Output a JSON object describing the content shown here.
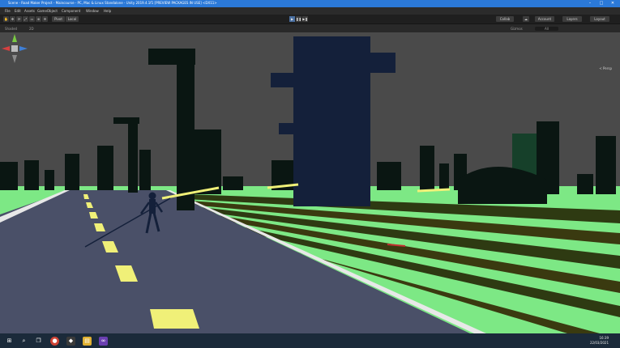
{
  "window": {
    "title": "Scene - Road Maker Project - Maincourse - PC, Mac & Linux Standalone - Unity 2019.4.1f1 [PREVIEW PACKAGES IN USE] <DX11>",
    "minimize": "–",
    "maximize": "□",
    "close": "✕"
  },
  "menu": [
    "File",
    "Edit",
    "Assets",
    "GameObject",
    "Component",
    "Window",
    "Help"
  ],
  "toolbar": {
    "tools": [
      "✋",
      "✥",
      "⟳",
      "⤢",
      "▭",
      "⊕",
      "✣"
    ],
    "pivot": "Pivot",
    "local": "Local",
    "play": "▶",
    "pause": "❚❚",
    "step": "▶❚",
    "collab": "Collab",
    "cloud": "☁",
    "account": "Account",
    "layers": "Layers",
    "layout": "Layout"
  },
  "scene_toolbar": {
    "shading": "Shaded",
    "mode_2d": "2D",
    "gizmos": "Gizmos",
    "search": "All"
  },
  "scene": {
    "gizmo_label": "< Persp",
    "sky_color": "#4a4a4a",
    "ground_color": "#7de885",
    "road_color": "#4a5068",
    "lane_color": "#f0f078",
    "building_color": "#0a1612",
    "tower_color": "#14203a"
  },
  "taskbar": {
    "icons": [
      "windows-icon",
      "search-icon",
      "task-view-icon",
      "chrome-icon",
      "unity-icon",
      "file-explorer-icon",
      "visual-studio-icon"
    ],
    "time": "16:39",
    "date": "22/03/2021"
  }
}
